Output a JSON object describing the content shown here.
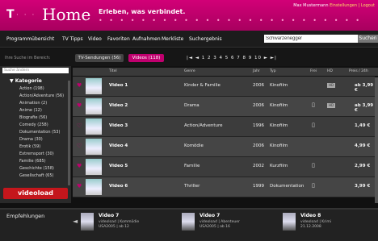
{
  "header": {
    "logo": "T",
    "dots": "· · ·",
    "title": "Home",
    "slogan": "Erleben, was verbindet.",
    "dotrow": "• • • • • • • • • • • • • • • • • • • • • • • • • • • • • • • • • • • • • • • • • • • • • • • • •",
    "user": "Max Mustermann",
    "user_links": "Einstellungen | Logout"
  },
  "nav": {
    "items": [
      "Programmübersicht",
      "TV Tipps",
      "Video",
      "Favoriten",
      "Aufnahmen",
      "Merkliste",
      "Suchergebnis"
    ],
    "search_value": "Schwarzenegger",
    "search_button": "Suchen"
  },
  "filter": {
    "label": "Ihre Suche im Bereich:",
    "tab_tv": "TV-Sendungen (56)",
    "tab_video": "Videos (118)",
    "pager": "|◄  ◄   1 2 3 4 5 6 7 8 9 10   ►  ►|"
  },
  "sidebar": {
    "search_placeholder": "Suche ändern",
    "title": "▼ Kategorie",
    "items": [
      "Action (198)",
      "Action/Adventure (56)",
      "Animation (2)",
      "Anime (12)",
      "Biografie (56)",
      "Comedy (258)",
      "Dokumentation (53)",
      "Drama (30)",
      "Erotik (59)",
      "Extremsport (30)",
      "Familie (685)",
      "Geschichte (158)",
      "Gesellschaft (65)"
    ],
    "logo": "videoload"
  },
  "table": {
    "headers": [
      "Titel",
      "Genre",
      "Jahr",
      "Typ",
      "Frei",
      "HD",
      "Preis / 24h"
    ],
    "rows": [
      {
        "title": "Video 1",
        "genre": "Kinder & Familie",
        "year": "2006",
        "type": "Kinofilm",
        "free": "",
        "hd": "HD",
        "price": "ab 3,99 €"
      },
      {
        "title": "Video 2",
        "genre": "Drama",
        "year": "2006",
        "type": "Kinofilm",
        "free": "▯",
        "hd": "HD",
        "price": "ab 3,99 €"
      },
      {
        "title": "Video 3",
        "genre": "Action/Adventure",
        "year": "1996",
        "type": "Kinofilm",
        "free": "▯",
        "hd": "",
        "price": "1,49 €"
      },
      {
        "title": "Video 4",
        "genre": "Komödie",
        "year": "2006",
        "type": "Kinofilm",
        "free": "",
        "hd": "",
        "price": "4,99 €"
      },
      {
        "title": "Video 5",
        "genre": "Familie",
        "year": "2002",
        "type": "Kurzfilm",
        "free": "▯",
        "hd": "",
        "price": "2,99 €"
      },
      {
        "title": "Video 6",
        "genre": "Thriller",
        "year": "1999",
        "type": "Dokumentation",
        "free": "▯",
        "hd": "",
        "price": "3,99 €"
      }
    ]
  },
  "recommendations": {
    "label": "Empfehlungen",
    "items": [
      {
        "title": "Video 7",
        "sub": "videoload | Kommödie",
        "sub2": "USA2005 | ab 12"
      },
      {
        "title": "Video 7",
        "sub": "videoload | Abenteuer",
        "sub2": "USA2005 | ab 16"
      },
      {
        "title": "Video 8",
        "sub": "videoload | Krimi",
        "sub2": "21.12.2008"
      }
    ]
  },
  "colors": {
    "brand": "#c0006e",
    "accent": "#c4161c"
  }
}
